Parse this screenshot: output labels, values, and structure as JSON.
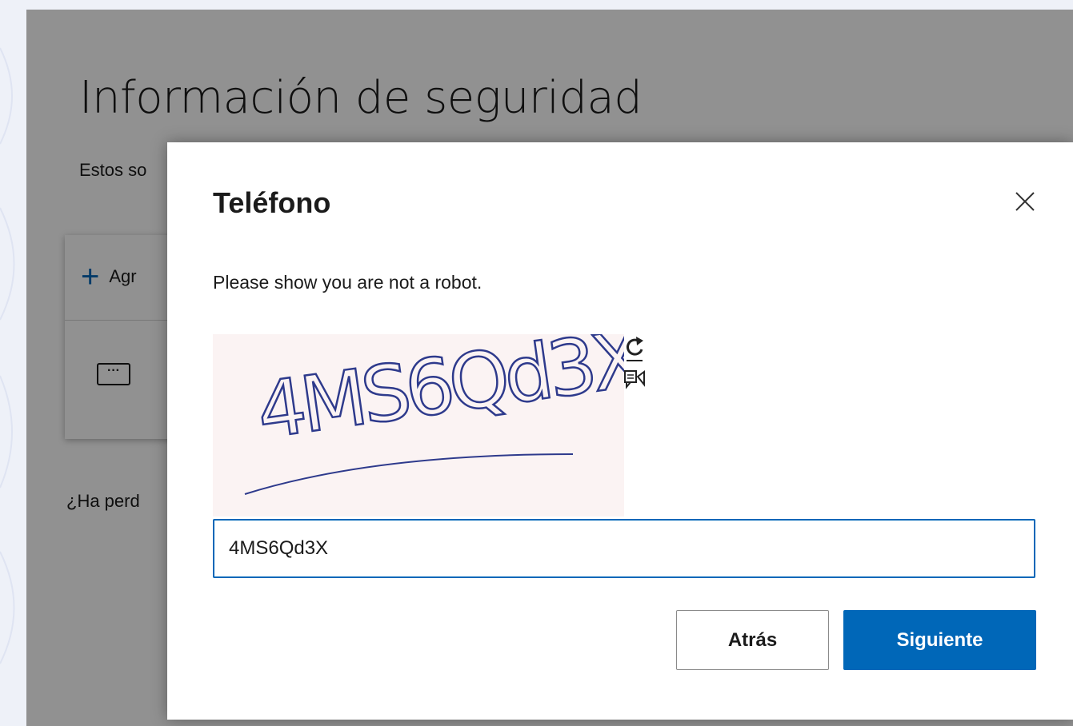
{
  "page": {
    "title": "Información de seguridad",
    "subtitle_visible": "Estos so",
    "add_method_label_visible": "Agr",
    "lost_device_visible": "¿Ha perd"
  },
  "dialog": {
    "title": "Teléfono",
    "prompt": "Please show you are not a robot.",
    "captcha_text": "4MS6Qd3X",
    "input_value": "4MS6Qd3X",
    "back_label": "Atrás",
    "next_label": "Siguiente"
  },
  "icons": {
    "close": "close-icon",
    "refresh": "refresh-icon",
    "audio": "audio-captcha-icon",
    "plus": "plus-icon",
    "method": "more-dots-icon"
  },
  "colors": {
    "accent": "#0067b8",
    "overlay": "rgba(0,0,0,0.43)"
  }
}
